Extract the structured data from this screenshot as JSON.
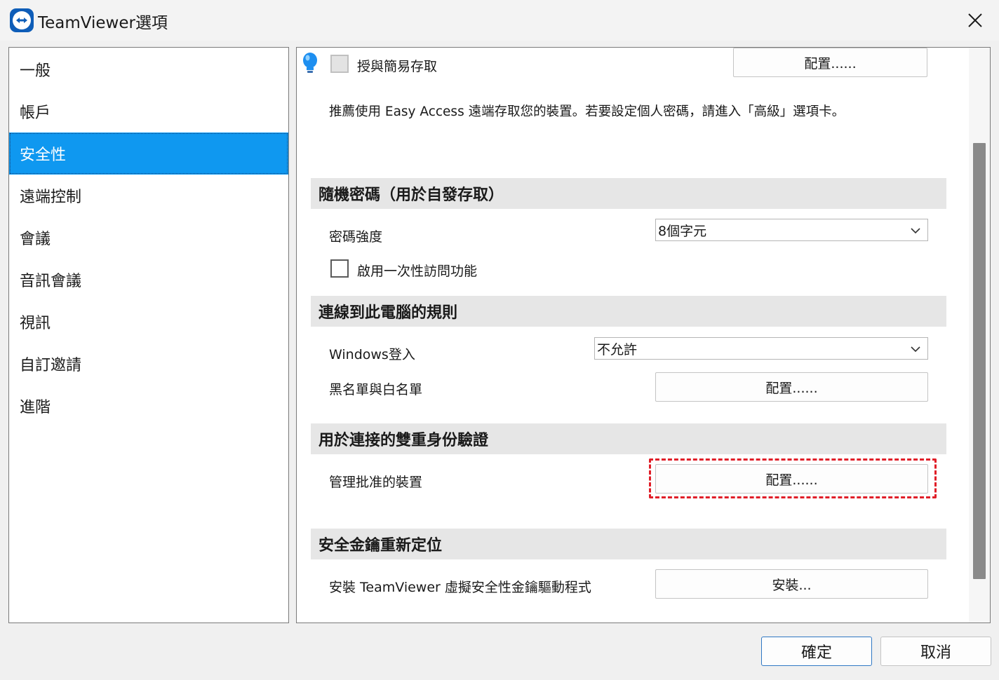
{
  "window": {
    "title": "TeamViewer選項",
    "app_icon": "teamviewer-logo-icon",
    "close_icon": "close-icon"
  },
  "sidebar": {
    "selected": "安全性",
    "items": [
      {
        "label": "一般"
      },
      {
        "label": "帳戶"
      },
      {
        "label": "安全性"
      },
      {
        "label": "遠端控制"
      },
      {
        "label": "會議"
      },
      {
        "label": "音訊會議"
      },
      {
        "label": "視訊"
      },
      {
        "label": "自訂邀請"
      },
      {
        "label": "進階"
      }
    ]
  },
  "easy_access": {
    "icon": "lightbulb-icon",
    "checkbox_label": "授與簡易存取",
    "checked": false,
    "configure_label": "配置......",
    "description": "推薦使用 Easy Access 遠端存取您的裝置。若要設定個人密碼，請進入「高級」選項卡。"
  },
  "random_password": {
    "header": "隨機密碼（用於自發存取）",
    "strength_label": "密碼強度",
    "strength_value": "8個字元",
    "one_time_label": "啟用一次性訪問功能",
    "one_time_checked": false
  },
  "rules": {
    "header": "連線到此電腦的規則",
    "windows_login_label": "Windows登入",
    "windows_login_value": "不允許",
    "blacklist_label": "黑名單與白名單",
    "blacklist_button": "配置......"
  },
  "two_factor": {
    "header": "用於連接的雙重身份驗證",
    "devices_label": "管理批准的裝置",
    "devices_button": "配置......"
  },
  "security_key": {
    "header": "安全金鑰重新定位",
    "install_label": "安裝 TeamViewer 虛擬安全性金鑰驅動程式",
    "install_button": "安裝..."
  },
  "footer": {
    "ok_label": "確定",
    "cancel_label": "取消"
  },
  "colors": {
    "selection": "#0f98f0",
    "highlight_dashed": "#e01e28",
    "brand": "#0e5db8"
  }
}
